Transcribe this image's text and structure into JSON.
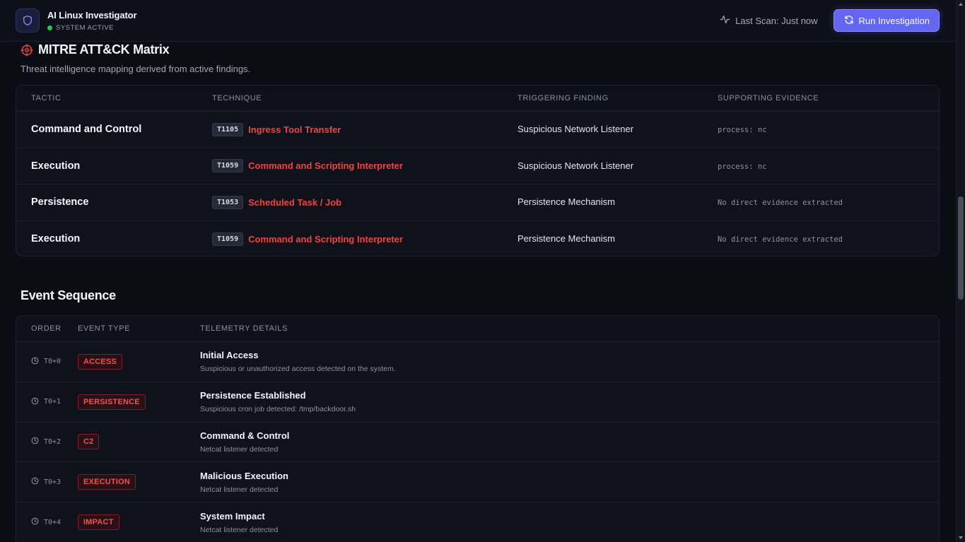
{
  "header": {
    "app_title": "AI Linux Investigator",
    "status": "SYSTEM ACTIVE",
    "last_scan": "Last Scan: Just now",
    "run_button": "Run Investigation"
  },
  "mitre": {
    "title": "MITRE ATT&CK Matrix",
    "subtitle": "Threat intelligence mapping derived from active findings.",
    "columns": [
      "TACTIC",
      "TECHNIQUE",
      "TRIGGERING FINDING",
      "SUPPORTING EVIDENCE"
    ],
    "rows": [
      {
        "tactic": "Command and Control",
        "technique_id": "T1105",
        "technique": "Ingress Tool Transfer",
        "finding": "Suspicious Network Listener",
        "evidence": "process: nc"
      },
      {
        "tactic": "Execution",
        "technique_id": "T1059",
        "technique": "Command and Scripting Interpreter",
        "finding": "Suspicious Network Listener",
        "evidence": "process: nc"
      },
      {
        "tactic": "Persistence",
        "technique_id": "T1053",
        "technique": "Scheduled Task / Job",
        "finding": "Persistence Mechanism",
        "evidence": "No direct evidence extracted"
      },
      {
        "tactic": "Execution",
        "technique_id": "T1059",
        "technique": "Command and Scripting Interpreter",
        "finding": "Persistence Mechanism",
        "evidence": "No direct evidence extracted"
      }
    ]
  },
  "events": {
    "title": "Event Sequence",
    "columns": [
      "ORDER",
      "EVENT TYPE",
      "TELEMETRY DETAILS"
    ],
    "rows": [
      {
        "order": "T0+0",
        "type": "ACCESS",
        "title": "Initial Access",
        "detail": "Suspicious or unauthorized access detected on the system."
      },
      {
        "order": "T0+1",
        "type": "PERSISTENCE",
        "title": "Persistence Established",
        "detail": "Suspicious cron job detected: /tmp/backdoor.sh"
      },
      {
        "order": "T0+2",
        "type": "C2",
        "title": "Command & Control",
        "detail": "Netcat listener detected"
      },
      {
        "order": "T0+3",
        "type": "EXECUTION",
        "title": "Malicious Execution",
        "detail": "Netcat listener detected"
      },
      {
        "order": "T0+4",
        "type": "IMPACT",
        "title": "System Impact",
        "detail": "Netcat listener detected"
      }
    ]
  },
  "icons": {
    "logo": "shield-icon",
    "last_scan": "activity-pulse-icon",
    "run": "refresh-icon",
    "mitre": "crosshair-target-icon",
    "order": "clock-icon"
  },
  "colors": {
    "background": "#0b0d14",
    "accent": "#6366f1",
    "danger": "#ef4444",
    "status_ok": "#22c55e"
  }
}
